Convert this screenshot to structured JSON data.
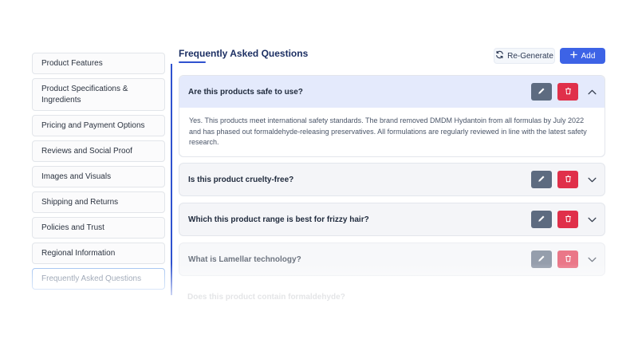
{
  "sidebar": {
    "items": [
      {
        "label": "Product Features"
      },
      {
        "label": "Product Specifications & Ingredients"
      },
      {
        "label": "Pricing and Payment Options"
      },
      {
        "label": "Reviews and Social Proof"
      },
      {
        "label": "Images and Visuals"
      },
      {
        "label": "Shipping and Returns"
      },
      {
        "label": "Policies and Trust"
      },
      {
        "label": "Regional Information"
      },
      {
        "label": "Frequently Asked Questions"
      }
    ]
  },
  "header": {
    "title": "Frequently Asked Questions",
    "regenerate_label": "Re-Generate",
    "add_label": "Add"
  },
  "faqs": [
    {
      "question": "Are this products safe to use?",
      "answer": "Yes. This products meet international safety standards. The brand removed DMDM Hydantoin from all formulas by July 2022 and has phased out formaldehyde-releasing preservatives. All formulations are regularly reviewed in line with the latest safety research.",
      "expanded": true
    },
    {
      "question": "Is this product cruelty-free?",
      "expanded": false
    },
    {
      "question": "Which this product range is best for frizzy hair?",
      "expanded": false
    },
    {
      "question": "What is Lamellar technology?",
      "expanded": false
    },
    {
      "question": "Does this product contain formaldehyde?",
      "expanded": false
    }
  ],
  "icons": {
    "regenerate": "refresh-icon",
    "add": "plus-icon",
    "edit": "pencil-icon",
    "delete": "trash-icon",
    "expand": "chevron-down-icon",
    "collapse": "chevron-up-icon"
  },
  "colors": {
    "accent": "#3d63e6",
    "title": "#1c2f63",
    "edit_button": "#5d6b80",
    "delete_button": "#e0304a",
    "open_header": "#e4eafc"
  }
}
